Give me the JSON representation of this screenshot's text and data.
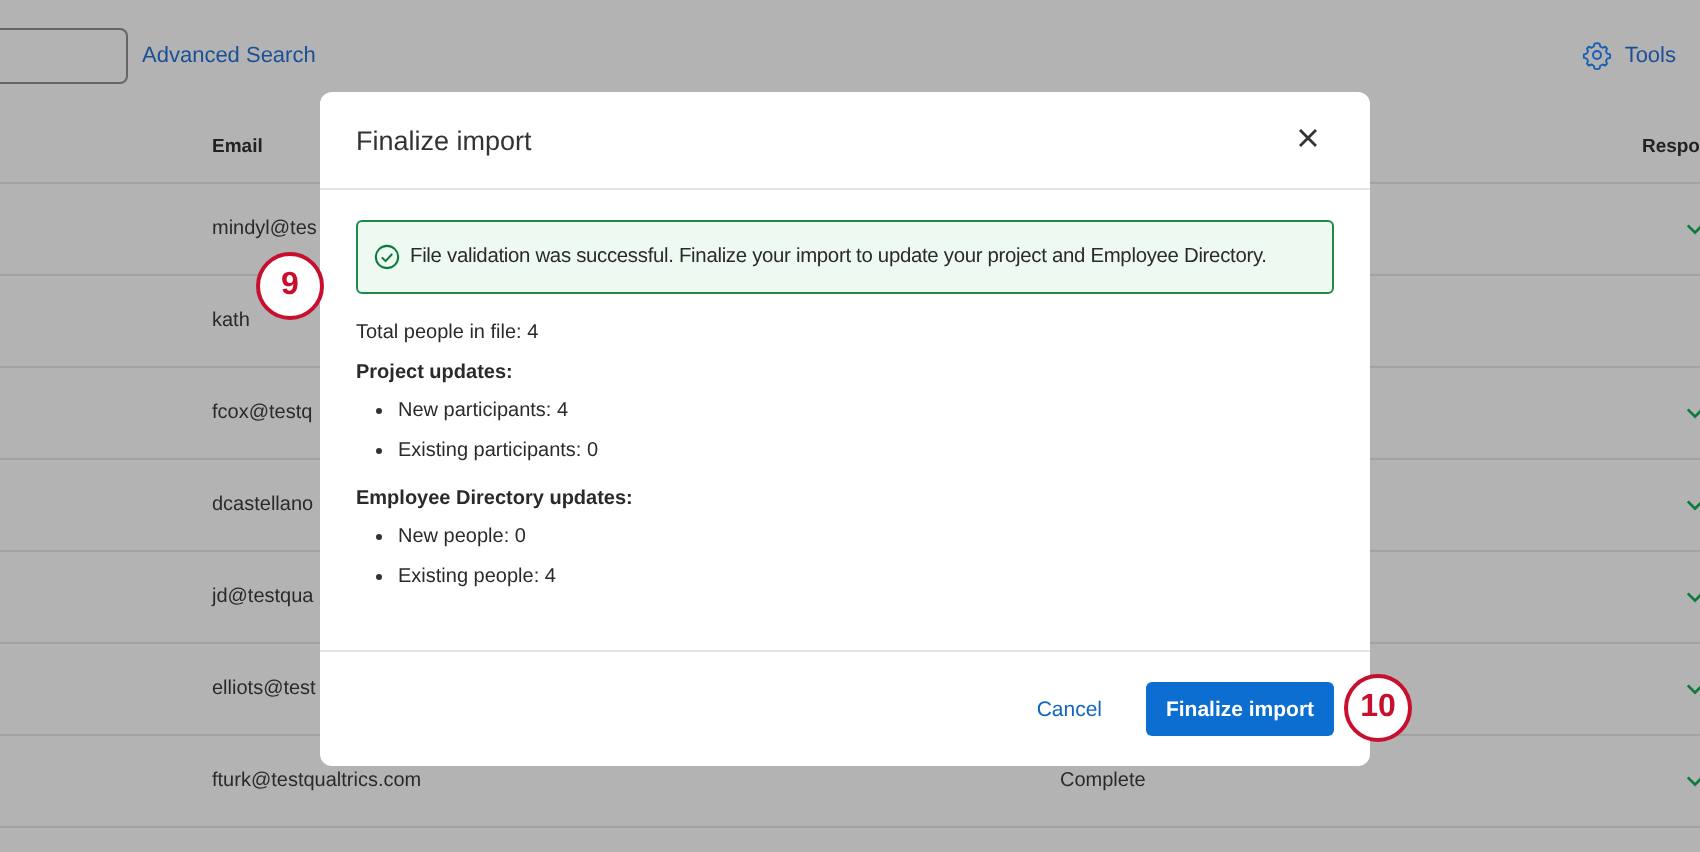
{
  "toolbar": {
    "advanced_search": "Advanced Search",
    "tools": "Tools"
  },
  "table": {
    "headers": [
      {
        "kind": "email",
        "label": "Email"
      },
      {
        "kind": "response",
        "label": "Respo"
      }
    ],
    "rows": [
      {
        "email": "mindyl@tes",
        "responded": true
      },
      {
        "email": "kath",
        "responded": false
      },
      {
        "email": "fcox@testq",
        "responded": true
      },
      {
        "email": "dcastellano",
        "responded": true
      },
      {
        "email": "jd@testqua",
        "responded": true
      },
      {
        "email": "elliots@test",
        "responded": true
      },
      {
        "email": "fturk@testqualtrics.com",
        "status": "Complete",
        "responded": true
      }
    ]
  },
  "dialog": {
    "title": "Finalize import",
    "alert": "File validation was successful. Finalize your import to update your project and Employee Directory.",
    "total": "Total people in file: 4",
    "sections": [
      {
        "heading": "Project updates:",
        "items": [
          "New participants: 4",
          "Existing participants: 0"
        ]
      },
      {
        "heading": "Employee Directory updates:",
        "items": [
          "New people: 0",
          "Existing people: 4"
        ]
      }
    ],
    "buttons": [
      {
        "kind": "link",
        "label": "Cancel"
      },
      {
        "kind": "primary",
        "label": "Finalize import"
      }
    ]
  },
  "callouts": [
    "9",
    "10"
  ]
}
